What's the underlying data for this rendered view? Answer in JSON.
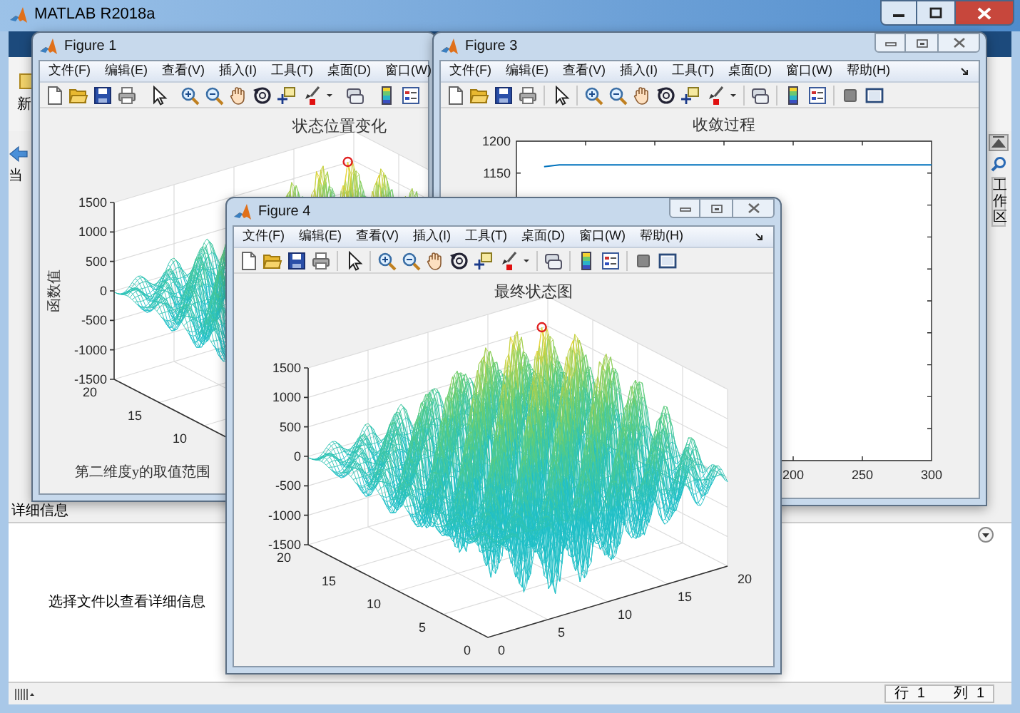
{
  "main_window": {
    "title": "MATLAB R2018a",
    "toolstrip_item": "新",
    "folder_panel_label": "当",
    "details_panel": {
      "header": "详细信息",
      "message": "选择文件以查看详细信息"
    },
    "workspace_tab": "工作区",
    "status_bar": {
      "row_label": "行",
      "row_value": "1",
      "column_label": "列",
      "column_value": "1"
    }
  },
  "figures": [
    {
      "title": "Figure 1",
      "menu": [
        "文件(F)",
        "编辑(E)",
        "查看(V)",
        "插入(I)",
        "工具(T)",
        "桌面(D)",
        "窗口(W)"
      ],
      "plot": {
        "kind": "surface",
        "title": "状态位置变化",
        "ylabel": "函数值",
        "xlabel": "第二维度y的取值范围",
        "zticks": [
          "1500",
          "1000",
          "500",
          "0",
          "-500",
          "-1000",
          "-1500"
        ],
        "yticks": [
          "20",
          "15",
          "10"
        ]
      }
    },
    {
      "title": "Figure 3",
      "menu": [
        "文件(F)",
        "编辑(E)",
        "查看(V)",
        "插入(I)",
        "工具(T)",
        "桌面(D)",
        "窗口(W)",
        "帮助(H)"
      ],
      "plot": {
        "kind": "line",
        "chart_data": {
          "type": "line",
          "title": "收敛过程",
          "x": [
            20,
            31,
            300
          ],
          "series": [
            {
              "color": "#0072bd",
              "values": [
                1160,
                1163,
                1163
              ]
            }
          ],
          "xlim": [
            0,
            300
          ],
          "ylim": [
            700,
            1200
          ],
          "xticks": [
            200,
            250,
            300
          ],
          "yticks": [
            1150,
            1200
          ]
        }
      }
    },
    {
      "title": "Figure 4",
      "menu": [
        "文件(F)",
        "编辑(E)",
        "查看(V)",
        "插入(I)",
        "工具(T)",
        "桌面(D)",
        "窗口(W)",
        "帮助(H)"
      ],
      "plot": {
        "kind": "surface",
        "title": "最终状态图",
        "zticks": [
          "1500",
          "1000",
          "500",
          "0",
          "-500",
          "-1000",
          "-1500"
        ],
        "yticks": [
          "20",
          "15",
          "10",
          "5",
          "0"
        ],
        "xticks": [
          "0",
          "5",
          "10",
          "15",
          "20"
        ]
      }
    }
  ]
}
